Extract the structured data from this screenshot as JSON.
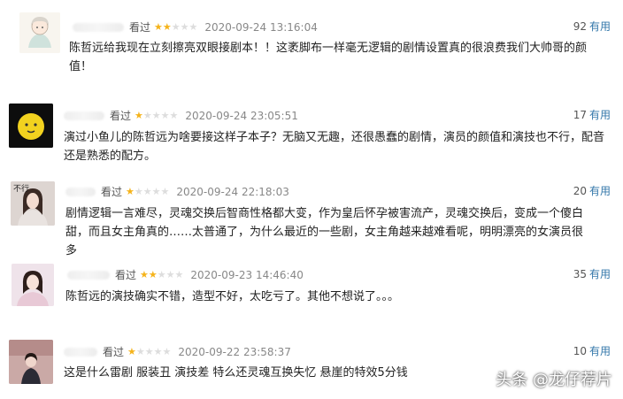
{
  "reviews": [
    {
      "label": "看过",
      "rating": 2,
      "time": "2020-09-24 13:16:04",
      "useful_count": "92",
      "useful_text": "有用",
      "content": "陈哲远给我现在立刻擦亮双眼接剧本！！这袤脚布一样毫无逻辑的剧情设置真的很浪费我们大帅哥的颜值！"
    },
    {
      "label": "看过",
      "rating": 1,
      "time": "2020-09-24 23:05:51",
      "useful_count": "17",
      "useful_text": "有用",
      "content": "演过小鱼儿的陈哲远为啥要接这样子本子？无脑又无趣，还很愚蠢的剧情，演员的颜值和演技也不行，配音还是熟悉的配方。"
    },
    {
      "label": "看过",
      "rating": 1,
      "time": "2020-09-24 22:18:03",
      "useful_count": "20",
      "useful_text": "有用",
      "content": "剧情逻辑一言难尽，灵魂交换后智商性格都大变，作为皇后怀孕被害流产，灵魂交换后，变成一个傻白甜，而且女主角真的……太普通了，为什么最近的一些剧，女主角越来越难看呢，明明漂亮的女演员很多"
    },
    {
      "label": "看过",
      "rating": 2,
      "time": "2020-09-23 14:46:40",
      "useful_count": "35",
      "useful_text": "有用",
      "content": "陈哲远的演技确实不错，造型不好，太吃亏了。其他不想说了。。。"
    },
    {
      "label": "看过",
      "rating": 1,
      "time": "2020-09-22 23:58:37",
      "useful_count": "10",
      "useful_text": "有用",
      "content": "这是什么雷剧 服装丑 演技差 特么还灵魂互换失忆 悬崖的特效5分钱"
    }
  ],
  "watermark": "头条 @龙仔荐片",
  "colors": {
    "star_on": "#f5b31a",
    "star_off": "#dddddd",
    "useful_link": "#3377aa"
  }
}
